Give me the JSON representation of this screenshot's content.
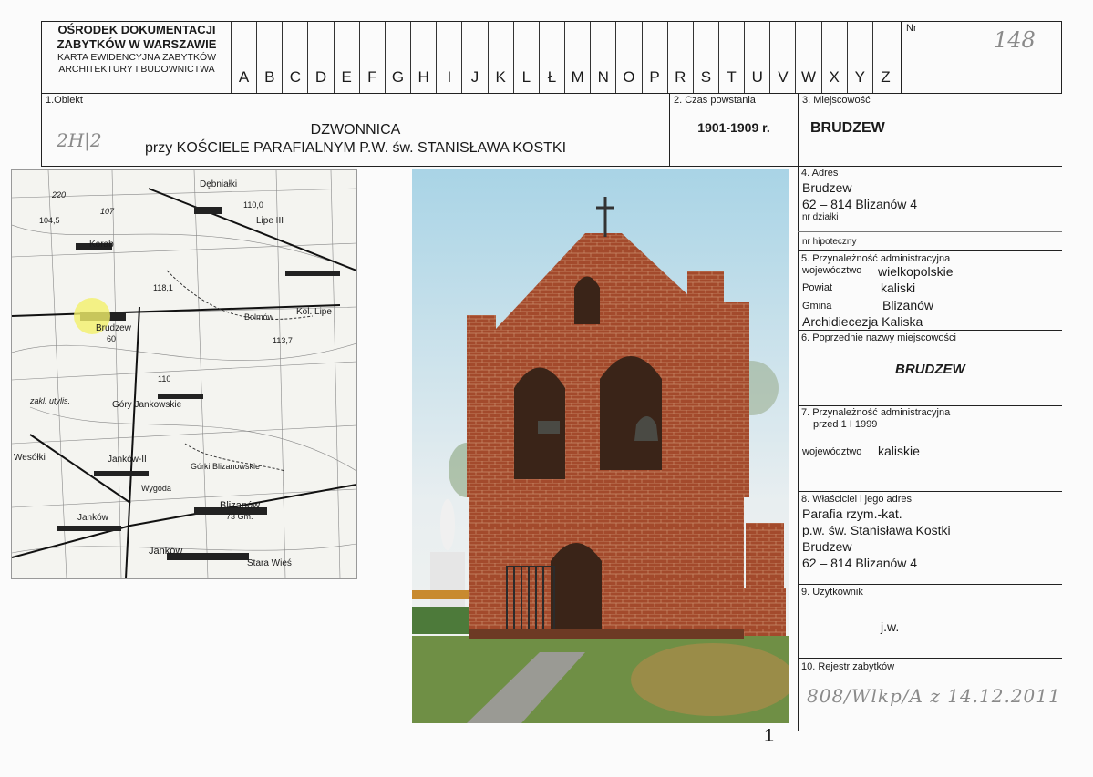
{
  "header": {
    "institution_line1": "OŚRODEK DOKUMENTACJI",
    "institution_line2": "ZABYTKÓW W WARSZAWIE",
    "card_line1": "KARTA EWIDENCYJNA ZABYTKÓW",
    "card_line2": "ARCHITEKTURY I BUDOWNICTWA",
    "letters": [
      "A",
      "B",
      "C",
      "D",
      "E",
      "F",
      "G",
      "H",
      "I",
      "J",
      "K",
      "L",
      "Ł",
      "M",
      "N",
      "O",
      "P",
      "R",
      "S",
      "T",
      "U",
      "V",
      "W",
      "X",
      "Y",
      "Z"
    ],
    "nr_label": "Nr",
    "nr_value": "148"
  },
  "object": {
    "label": "1.Obiekt",
    "handwritten_code": "2H|2",
    "name_line1": "DZWONNICA",
    "name_line2": "przy KOŚCIELE PARAFIALNYM P.W. św. STANISŁAWA KOSTKI"
  },
  "time": {
    "label": "2. Czas powstania",
    "value": "1901-1909 r."
  },
  "place": {
    "label": "3. Miejscowość",
    "value": "BRUDZEW"
  },
  "address": {
    "label": "4. Adres",
    "line1": "Brudzew",
    "line2": "62 – 814 Blizanów 4",
    "plot_label": "nr działki",
    "mortgage_label": "nr hipoteczny"
  },
  "admin": {
    "label": "5. Przynależność administracyjna",
    "voivodeship_label": "województwo",
    "voivodeship": "wielkopolskie",
    "county_label": "Powiat",
    "county": "kaliski",
    "commune_label": "Gmina",
    "commune": "Blizanów",
    "archdiocese": "Archidiecezja Kaliska"
  },
  "prev_names": {
    "label": "6. Poprzednie nazwy miejscowości",
    "value": "BRUDZEW"
  },
  "admin_before": {
    "label": "7. Przynależność administracyjna",
    "sublabel": "przed 1 I 1999",
    "voivodeship_label": "województwo",
    "voivodeship": "kaliskie"
  },
  "owner": {
    "label": "8. Właściciel i jego adres",
    "line1": "Parafia rzym.-kat.",
    "line2": "p.w. św. Stanisława Kostki",
    "line3": "Brudzew",
    "line4": "62 – 814 Blizanów 4"
  },
  "user": {
    "label": "9. Użytkownik",
    "value": "j.w."
  },
  "register": {
    "label": "10. Rejestr zabytków",
    "value": "808/Wlkp/A z 14.12.2011"
  },
  "page_number": "1",
  "map_labels": {
    "debniatki": "Dębniałki",
    "lipe3": "Lipe III",
    "korab": "Korab",
    "brudzew": "Brudzew",
    "bolmow": "Bolmów",
    "kol_lipe": "Kol. Lipe",
    "gory_jankowskie": "Góry Jankowskie",
    "zakl": "zakl. utylis.",
    "wesolki": "Wesółki",
    "jankow2": "Janków-II",
    "gorki": "Górki Blizanowskie",
    "wygoda": "Wygoda",
    "blizanow": "Blizanów",
    "gm": "73 Gm.",
    "jankow": "Janków",
    "stara_wies": "Stara Wieś",
    "n220": "220",
    "n107": "107",
    "n1045": "104,5",
    "n1181": "118,1",
    "n1100": "110,0",
    "n60": "60",
    "n1137": "113,7",
    "n110": "110"
  }
}
